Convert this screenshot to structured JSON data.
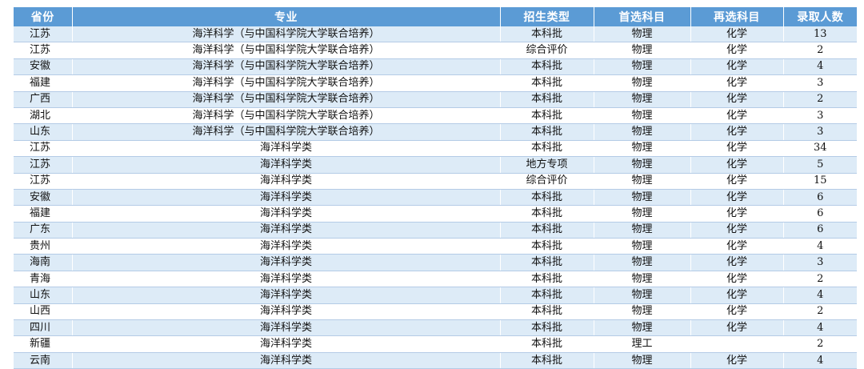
{
  "table": {
    "headers": [
      "省份",
      "专业",
      "招生类型",
      "首选科目",
      "再选科目",
      "录取人数"
    ],
    "rows": [
      [
        "江苏",
        "海洋科学（与中国科学院大学联合培养）",
        "本科批",
        "物理",
        "化学",
        "13"
      ],
      [
        "江苏",
        "海洋科学（与中国科学院大学联合培养）",
        "综合评价",
        "物理",
        "化学",
        "2"
      ],
      [
        "安徽",
        "海洋科学（与中国科学院大学联合培养）",
        "本科批",
        "物理",
        "化学",
        "4"
      ],
      [
        "福建",
        "海洋科学（与中国科学院大学联合培养）",
        "本科批",
        "物理",
        "化学",
        "3"
      ],
      [
        "广西",
        "海洋科学（与中国科学院大学联合培养）",
        "本科批",
        "物理",
        "化学",
        "2"
      ],
      [
        "湖北",
        "海洋科学（与中国科学院大学联合培养）",
        "本科批",
        "物理",
        "化学",
        "3"
      ],
      [
        "山东",
        "海洋科学（与中国科学院大学联合培养）",
        "本科批",
        "物理",
        "化学",
        "3"
      ],
      [
        "江苏",
        "海洋科学类",
        "本科批",
        "物理",
        "化学",
        "34"
      ],
      [
        "江苏",
        "海洋科学类",
        "地方专项",
        "物理",
        "化学",
        "5"
      ],
      [
        "江苏",
        "海洋科学类",
        "综合评价",
        "物理",
        "化学",
        "15"
      ],
      [
        "安徽",
        "海洋科学类",
        "本科批",
        "物理",
        "化学",
        "6"
      ],
      [
        "福建",
        "海洋科学类",
        "本科批",
        "物理",
        "化学",
        "6"
      ],
      [
        "广东",
        "海洋科学类",
        "本科批",
        "物理",
        "化学",
        "6"
      ],
      [
        "贵州",
        "海洋科学类",
        "本科批",
        "物理",
        "化学",
        "4"
      ],
      [
        "海南",
        "海洋科学类",
        "本科批",
        "物理",
        "化学",
        "3"
      ],
      [
        "青海",
        "海洋科学类",
        "本科批",
        "物理",
        "化学",
        "2"
      ],
      [
        "山东",
        "海洋科学类",
        "本科批",
        "物理",
        "化学",
        "4"
      ],
      [
        "山西",
        "海洋科学类",
        "本科批",
        "物理",
        "化学",
        "2"
      ],
      [
        "四川",
        "海洋科学类",
        "本科批",
        "物理",
        "化学",
        "4"
      ],
      [
        "新疆",
        "海洋科学类",
        "本科批",
        "理工",
        "",
        "2"
      ],
      [
        "云南",
        "海洋科学类",
        "本科批",
        "物理",
        "化学",
        "4"
      ]
    ]
  },
  "colors": {
    "header_bg": "#5b9bd5",
    "header_text": "#ffffff",
    "row_stripe": "#ddebf7"
  }
}
